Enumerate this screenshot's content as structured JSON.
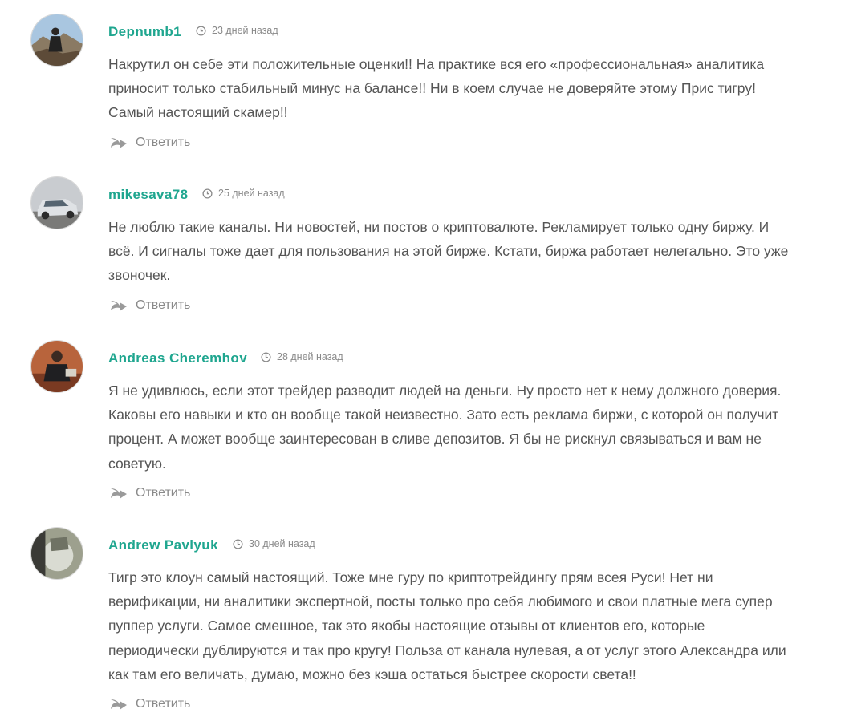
{
  "comments": [
    {
      "author": "Depnumb1",
      "time": "23 дней назад",
      "text": "Накрутил он себе эти положительные оценки!! На практике вся его «профессиональная» аналитика приносит только стабильный минус на балансе!! Ни в коем случае не доверяйте этому Прис тигру! Самый настоящий скамер!!",
      "reply_label": "Ответить"
    },
    {
      "author": "mikesava78",
      "time": "25 дней назад",
      "text": "Не люблю такие каналы. Ни новостей, ни постов о криптовалюте. Рекламирует только одну биржу. И всё. И сигналы тоже дает для пользования на этой бирже. Кстати, биржа работает нелегально. Это уже звоночек.",
      "reply_label": "Ответить"
    },
    {
      "author": "Andreas Cheremhov",
      "time": "28 дней назад",
      "text": "Я не удивлюсь, если этот трейдер разводит людей на деньги. Ну просто нет к нему должного доверия. Каковы его навыки и кто он вообще такой неизвестно. Зато есть реклама биржи, с которой он получит процент. А может вообще заинтересован в сливе депозитов. Я бы не рискнул связываться и вам не советую.",
      "reply_label": "Ответить"
    },
    {
      "author": "Andrew Pavlyuk",
      "time": "30 дней назад",
      "text": "Тигр это клоун самый настоящий. Тоже мне гуру по криптотрейдингу прям всея Руси! Нет ни верификации, ни аналитики экспертной, посты только про себя любимого и свои платные мега супер пуппер услуги. Самое смешное, так это якобы настоящие отзывы от клиентов его, которые периодически дублируются и так про кругу! Польза от канала нулевая, а от услуг этого Александра или как там его величать, думаю, можно без кэша остаться быстрее скорости света!!",
      "reply_label": "Ответить"
    }
  ],
  "colors": {
    "author": "#1fa68f",
    "text": "#555555",
    "meta": "#8a8a8a"
  },
  "icons": {
    "time": "clock-icon",
    "reply": "reply-arrow-icon"
  }
}
